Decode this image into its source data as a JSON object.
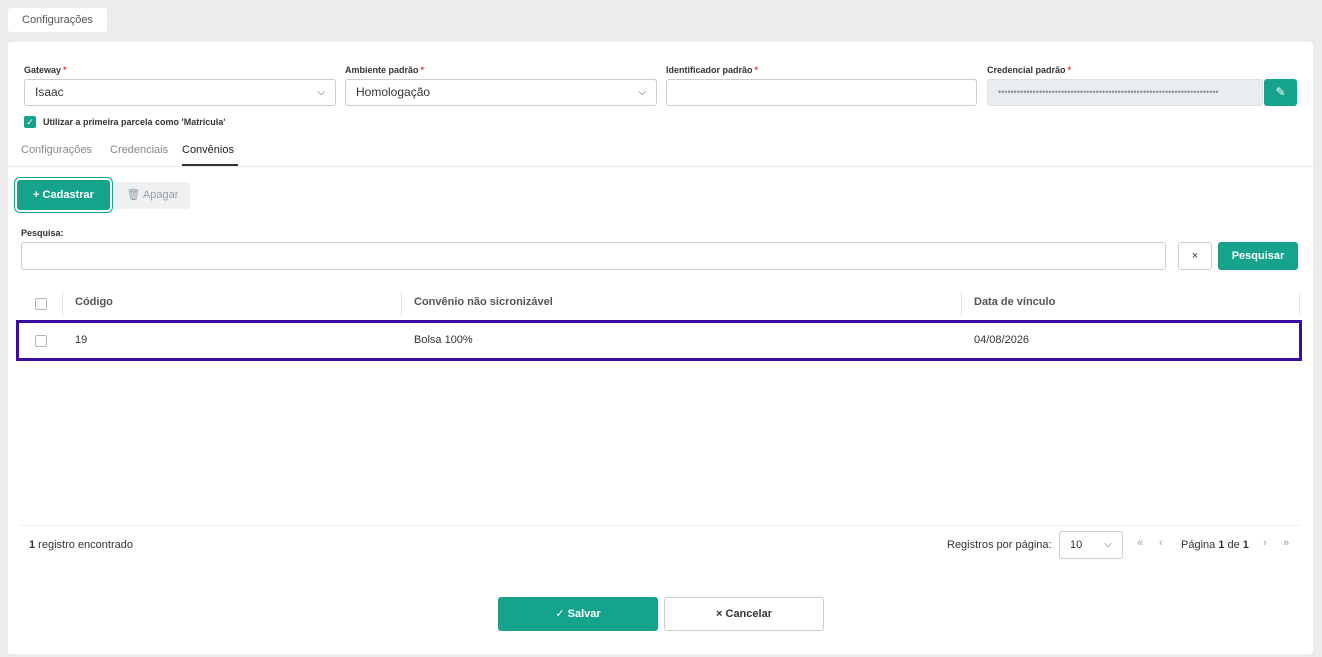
{
  "top_tab": {
    "label": "Configurações"
  },
  "form": {
    "gateway": {
      "label": "Gateway",
      "required": "*",
      "value": "Isaac"
    },
    "ambiente": {
      "label": "Ambiente padrão",
      "required": "*",
      "value": "Homologação"
    },
    "identificador": {
      "label": "Identificador padrão",
      "required": "*",
      "value": ""
    },
    "credencial": {
      "label": "Credencial padrão",
      "required": "*",
      "value": "••••••••••••••••••••••••••••••••••••••••••••••••••••••••••••••••••••••"
    },
    "primeira_parcela": {
      "label": "Utilizar a primeira parcela como 'Matrícula'",
      "checked": true
    }
  },
  "tabs": [
    {
      "label": "Configurações"
    },
    {
      "label": "Credenciais"
    },
    {
      "label": "Convênios"
    }
  ],
  "toolbar": {
    "add_label": "+ Cadastrar",
    "delete_label": "Apagar"
  },
  "search": {
    "label": "Pesquisa:",
    "value": "",
    "clear_label": "×",
    "button_label": "Pesquisar"
  },
  "table": {
    "headers": [
      "Código",
      "Convênio não sicronizável",
      "Data de vínculo"
    ],
    "rows": [
      {
        "codigo": "19",
        "convenio": "Bolsa 100%",
        "data": "04/08/2026"
      }
    ]
  },
  "footer": {
    "count": "1",
    "count_suffix": " registro encontrado",
    "per_page_label": "Registros por página:",
    "per_page_value": "10",
    "page_prefix": "Página ",
    "page_current": "1",
    "page_of": " de ",
    "page_total": "1"
  },
  "actions": {
    "save_label": "Salvar",
    "cancel_label": "Cancelar"
  },
  "colors": {
    "accent": "#15a48b",
    "highlight": "#3a0ca3",
    "required": "#e53935"
  },
  "icons": {
    "save": "check-icon",
    "cancel": "x-icon",
    "delete": "trash-icon",
    "edit": "pencil-icon"
  }
}
